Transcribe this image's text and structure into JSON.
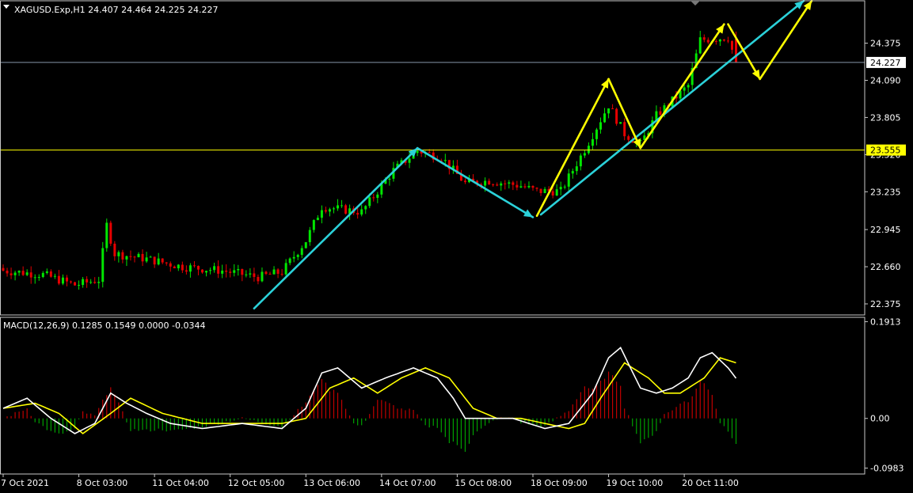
{
  "header": {
    "symbol_line": "XAGUSD.Exp,H1  24.407 24.464 24.225 24.227",
    "indicator_label": "MACD(12,26,9) 0.1285 0.1549 0.0000 -0.0344"
  },
  "colors": {
    "background": "#000000",
    "frame": "#c8c8c8",
    "bull_candle": "#00e600",
    "bear_candle": "#e60000",
    "level_line": "#ffff00",
    "current_price_line": "#8796a8",
    "cyan_arrows": "#2bd1d9",
    "yellow_arrows": "#ffff00",
    "macd_main": "#ffffff",
    "macd_signal": "#ffff00",
    "hist_positive": "#c00000",
    "hist_negative": "#00a000",
    "price_label_bg": "#ffff00",
    "price_label_text": "#000000"
  },
  "chart_data": [
    {
      "type": "candlestick",
      "panel": "price",
      "symbol": "XAGUSD.Exp",
      "timeframe": "H1",
      "ohlc_last": {
        "open": 24.407,
        "high": 24.464,
        "low": 24.225,
        "close": 24.227
      },
      "y_ticks": [
        "24.375",
        "24.090",
        "23.805",
        "23.520",
        "23.235",
        "22.945",
        "22.660",
        "22.375"
      ],
      "ylim": [
        22.29,
        24.7
      ],
      "current_price": 24.227,
      "current_price_label": "24.227",
      "horizontal_level": 23.555,
      "horizontal_level_label": "23.555",
      "x_tick_labels": [
        "7 Oct 2021",
        "8 Oct 03:00",
        "11 Oct 04:00",
        "12 Oct 05:00",
        "13 Oct 06:00",
        "14 Oct 07:00",
        "15 Oct 08:00",
        "18 Oct 09:00",
        "19 Oct 10:00",
        "20 Oct 11:00"
      ],
      "x_tick_bar_index": [
        0,
        19,
        38,
        57,
        76,
        95,
        114,
        133,
        152,
        171
      ],
      "anchors": [
        [
          0,
          22.63
        ],
        [
          10,
          22.6
        ],
        [
          18,
          22.52
        ],
        [
          24,
          22.56
        ],
        [
          26,
          22.98
        ],
        [
          28,
          22.76
        ],
        [
          36,
          22.72
        ],
        [
          45,
          22.66
        ],
        [
          55,
          22.63
        ],
        [
          64,
          22.58
        ],
        [
          70,
          22.62
        ],
        [
          76,
          22.86
        ],
        [
          80,
          23.12
        ],
        [
          90,
          23.08
        ],
        [
          98,
          23.4
        ],
        [
          104,
          23.55
        ],
        [
          110,
          23.5
        ],
        [
          116,
          23.3
        ],
        [
          122,
          23.32
        ],
        [
          130,
          23.28
        ],
        [
          134,
          23.24
        ],
        [
          140,
          23.24
        ],
        [
          146,
          23.56
        ],
        [
          152,
          23.9
        ],
        [
          156,
          23.68
        ],
        [
          160,
          23.6
        ],
        [
          164,
          23.82
        ],
        [
          172,
          24.05
        ],
        [
          175,
          24.4
        ],
        [
          182,
          24.42
        ],
        [
          184,
          24.227
        ]
      ],
      "arrows_cyan": [
        [
          [
            63,
            22.34
          ],
          [
            104,
            23.57
          ]
        ],
        [
          [
            104,
            23.57
          ],
          [
            133,
            23.04
          ]
        ],
        [
          [
            135,
            23.06
          ],
          [
            201,
            24.7
          ]
        ]
      ],
      "arrows_yellow": [
        [
          [
            134,
            23.05
          ],
          [
            152,
            24.1
          ]
        ],
        [
          [
            152,
            24.1
          ],
          [
            160,
            23.57
          ]
        ],
        [
          [
            160,
            23.57
          ],
          [
            181,
            24.52
          ]
        ],
        [
          [
            182,
            24.52
          ],
          [
            190,
            24.1
          ]
        ],
        [
          [
            190,
            24.1
          ],
          [
            203,
            24.7
          ]
        ]
      ]
    },
    {
      "type": "line+histogram",
      "panel": "macd",
      "name": "MACD(12,26,9)",
      "values_last": {
        "main": 0.1285,
        "signal": 0.1549,
        "zero": 0.0,
        "hist": -0.0344
      },
      "y_ticks": [
        "0.1913",
        "0.00",
        "-0.0983"
      ],
      "ylim": [
        -0.11,
        0.2
      ],
      "main_anchors": [
        [
          0,
          0.02
        ],
        [
          6,
          0.04
        ],
        [
          12,
          0.0
        ],
        [
          18,
          -0.03
        ],
        [
          23,
          -0.01
        ],
        [
          27,
          0.05
        ],
        [
          31,
          0.03
        ],
        [
          36,
          0.01
        ],
        [
          42,
          -0.01
        ],
        [
          50,
          -0.02
        ],
        [
          60,
          -0.01
        ],
        [
          70,
          -0.02
        ],
        [
          76,
          0.02
        ],
        [
          80,
          0.09
        ],
        [
          84,
          0.1
        ],
        [
          90,
          0.06
        ],
        [
          96,
          0.08
        ],
        [
          103,
          0.1
        ],
        [
          109,
          0.08
        ],
        [
          113,
          0.04
        ],
        [
          116,
          0.0
        ],
        [
          122,
          -0.0
        ],
        [
          128,
          0.0
        ],
        [
          136,
          -0.02
        ],
        [
          142,
          -0.01
        ],
        [
          148,
          0.05
        ],
        [
          152,
          0.12
        ],
        [
          155,
          0.14
        ],
        [
          160,
          0.06
        ],
        [
          164,
          0.05
        ],
        [
          168,
          0.06
        ],
        [
          172,
          0.08
        ],
        [
          175,
          0.12
        ],
        [
          178,
          0.13
        ],
        [
          182,
          0.1
        ],
        [
          184,
          0.0795
        ]
      ],
      "signal_anchors": [
        [
          0,
          0.02
        ],
        [
          8,
          0.03
        ],
        [
          14,
          0.01
        ],
        [
          20,
          -0.03
        ],
        [
          27,
          0.01
        ],
        [
          32,
          0.04
        ],
        [
          40,
          0.01
        ],
        [
          50,
          -0.01
        ],
        [
          60,
          -0.01
        ],
        [
          70,
          -0.01
        ],
        [
          76,
          0.0
        ],
        [
          82,
          0.06
        ],
        [
          88,
          0.08
        ],
        [
          94,
          0.05
        ],
        [
          100,
          0.08
        ],
        [
          106,
          0.1
        ],
        [
          112,
          0.08
        ],
        [
          118,
          0.02
        ],
        [
          124,
          -0.0
        ],
        [
          130,
          0.0
        ],
        [
          136,
          -0.01
        ],
        [
          142,
          -0.02
        ],
        [
          146,
          -0.01
        ],
        [
          150,
          0.04
        ],
        [
          156,
          0.11
        ],
        [
          162,
          0.08
        ],
        [
          166,
          0.05
        ],
        [
          170,
          0.05
        ],
        [
          176,
          0.08
        ],
        [
          180,
          0.12
        ],
        [
          184,
          0.11
        ]
      ]
    }
  ]
}
